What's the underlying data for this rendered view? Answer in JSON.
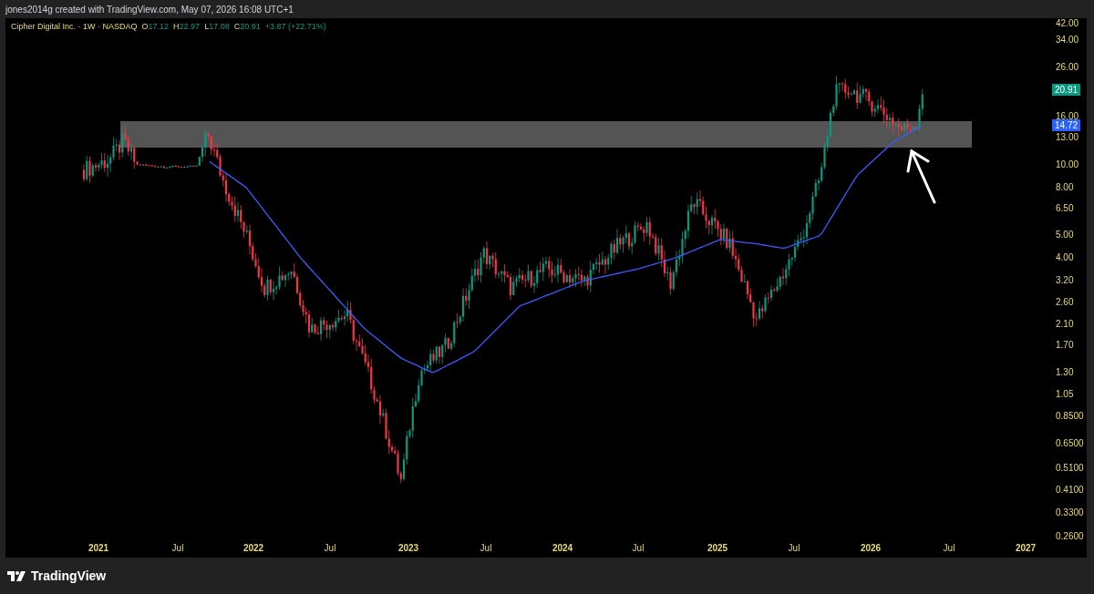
{
  "attribution": "jones2014g created with TradingView.com, May 07, 2026 16:08 UTC+1",
  "legend": {
    "symbol": "Cipher Digital Inc. · 1W · NASDAQ",
    "ohlc": [
      {
        "label": "O",
        "value": "17.12"
      },
      {
        "label": "H",
        "value": "22.97"
      },
      {
        "label": "L",
        "value": "17.08"
      },
      {
        "label": "C",
        "value": "20.91"
      }
    ],
    "change": "+3.87 (+22.71%)"
  },
  "price_axis": {
    "ticks": [
      "42.00",
      "34.00",
      "26.00",
      "16.00",
      "13.00",
      "10.00",
      "8.00",
      "6.50",
      "5.00",
      "4.00",
      "3.20",
      "2.60",
      "2.10",
      "1.70",
      "1.30",
      "1.05",
      "0.8500",
      "0.6500",
      "0.5100",
      "0.4100",
      "0.3300",
      "0.2600"
    ]
  },
  "price_tags": [
    {
      "text": "20.91",
      "color": "#089981"
    },
    {
      "text": "14.72",
      "color": "#2962ff"
    }
  ],
  "time_axis": {
    "ticks": [
      {
        "label": "2021",
        "kind": "year"
      },
      {
        "label": "Jul",
        "kind": "month"
      },
      {
        "label": "2022",
        "kind": "year"
      },
      {
        "label": "Jul",
        "kind": "month"
      },
      {
        "label": "2023",
        "kind": "year"
      },
      {
        "label": "Jul",
        "kind": "month"
      },
      {
        "label": "2024",
        "kind": "year"
      },
      {
        "label": "Jul",
        "kind": "month"
      },
      {
        "label": "2025",
        "kind": "year"
      },
      {
        "label": "Jul",
        "kind": "month"
      },
      {
        "label": "2026",
        "kind": "year"
      },
      {
        "label": "Jul",
        "kind": "month"
      },
      {
        "label": "2027",
        "kind": "year"
      }
    ]
  },
  "footer": {
    "brand": "TradingView"
  }
}
